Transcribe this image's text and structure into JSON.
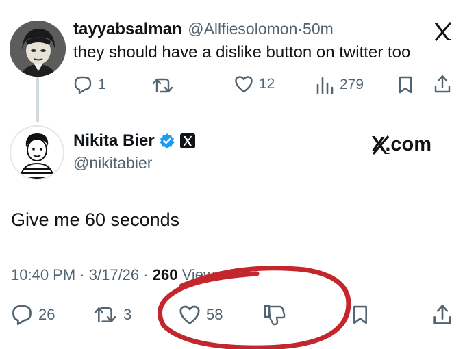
{
  "reply_tweet": {
    "author_name": "tayyabsalman",
    "author_handle": "@Allfiesolomon",
    "separator": "·",
    "time_ago": "50m",
    "text": "they should have a dislike button on twitter too",
    "metrics": {
      "replies": "1",
      "reposts": "",
      "likes": "12",
      "views": "279"
    }
  },
  "main_tweet": {
    "author_name": "Nikita Bier",
    "author_handle": "@nikitabier",
    "text": "Give me 60 seconds",
    "time": "10:40 PM",
    "separator": "·",
    "date": "3/17/26",
    "views_count": "260",
    "views_label": "Views",
    "metrics": {
      "replies": "26",
      "reposts": "3",
      "likes": "58"
    }
  },
  "watermark": "X.com",
  "annotation": {
    "color": "#c4262e"
  },
  "icons": [
    "x-logo-icon",
    "reply-icon",
    "repost-icon",
    "like-icon",
    "views-icon",
    "bookmark-icon",
    "share-icon",
    "verified-badge-icon",
    "dislike-icon"
  ]
}
